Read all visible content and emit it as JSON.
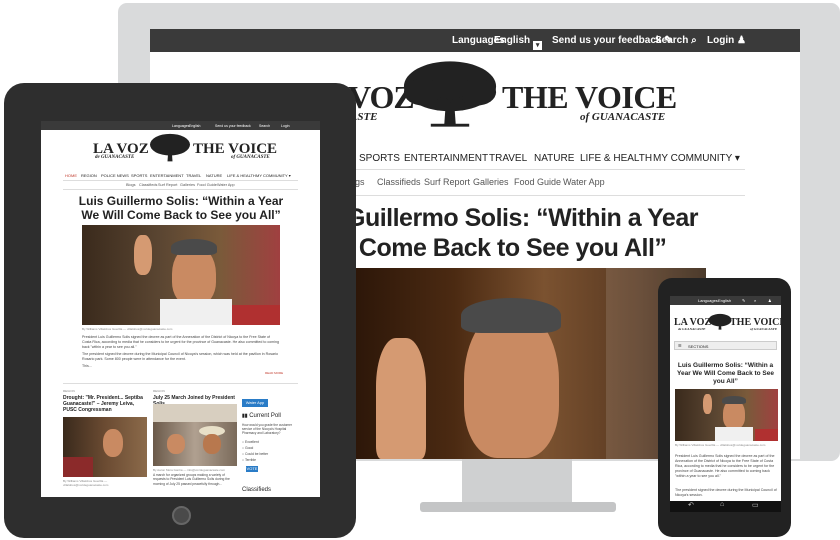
{
  "site": {
    "topbar": {
      "languages_label": "Languages",
      "language_value": "English",
      "feedback": "Send us your feedback",
      "search": "Search",
      "login": "Login"
    },
    "logo": {
      "left_title": "LA VOZ",
      "left_sub": "de GUANACASTE",
      "right_title": "THE VOICE",
      "right_sub": "of GUANACASTE"
    },
    "monitor_logo_left_visible": "VOZ",
    "monitor_logo_left_sub_visible": "ASTE",
    "nav": [
      "HOME",
      "REGION",
      "POLICE NEWS",
      "SPORTS",
      "ENTERTAINMENT",
      "TRAVEL",
      "NATURE",
      "LIFE & HEALTH",
      "MY COMMUNITY ▾"
    ],
    "monitor_nav": [
      "SPORTS",
      "ENTERTAINMENT",
      "TRAVEL",
      "NATURE",
      "LIFE & HEALTH",
      "MY COMMUNITY ▾"
    ],
    "subnav": [
      "Blogs",
      "Classifieds",
      "Surf Report",
      "Galleries",
      "Food Guide",
      "Water App"
    ],
    "monitor_subnav": [
      "ogs",
      "Classifieds",
      "Surf Report",
      "Galleries",
      "Food Guide",
      "Water App"
    ],
    "headline": "Luis Guillermo Solis: “Within a Year We Will Come Back to See you All”",
    "monitor_headline_lines": [
      "Guillermo Solis: “Within a Year",
      "l Come Back to See you All”"
    ],
    "tablet_headline_lines": [
      "Luis Guillermo Solis: “Within a Year",
      "We Will Come Back to See you All”"
    ],
    "phone_headline_lines": [
      "Luis Guillermo Solis: “Within a",
      "Year We Will Come Back to See",
      "you All”"
    ]
  },
  "tablet": {
    "photo_credit": "By Williams Villalobos Guerilla — villalobos@vozdeguanacaste.com",
    "body_paragraphs": [
      "President Luis Guillermo Solis signed the decree as part of the Annexation of the District of Nicoya to the Free State of Costa Rica, according to media that he considers to be urgent for the province of Guanacaste. He also committed to coming back \"within a year to see you all.\"",
      "The president signed the decree during the Municipal Council of Nicoya's session, which was held at the pavilion in Rosario Rosario park. Some 800 people were in attendance for the event.",
      "This..."
    ],
    "read_more": "READ MORE",
    "col1": {
      "kicker": "REGION",
      "title": "Drought: \"Mr. President... Septiba Guanacaste!\" – Jeremy Leiva, PUSC Congressman",
      "credit": "By Williams Villalobos Guerilla — villalobos@vozdeguanacaste.com"
    },
    "col2": {
      "kicker": "REGION",
      "title": "July 25 March Joined by President Solis",
      "credit": "By Aaron Mora Garcia — info@vozdeguanacaste.com",
      "text": "A march for organized groups making a variety of requests to President Luis Guillermo Solis during the morning of July 25 passed peacefully through..."
    },
    "sidebar": {
      "water_app": "Water App",
      "poll_title": "Current Poll",
      "poll_question": "How would you grade the customer service of the Nicoya's Hospital Pharmacy and Laboratory?",
      "poll_options": [
        "Excellent",
        "Good",
        "Could be better",
        "Terrible"
      ],
      "vote": "VOTE",
      "classifieds": "Classifieds"
    }
  },
  "phone": {
    "sections": "SECTIONS",
    "photo_credit": "By Williams Villalobos Guerilla — villalobos@vozdeguanacaste.com",
    "body_paragraphs": [
      "President Luis Guillermo Solis signed the decree as part of the Annexation of the District of Nicoya to the Free State of Costa Rica, according to media that he considers to be urgent for the province of Guanacaste. He also committed to coming back \"within a year to see you all.\"",
      "The president signed the decree during the Municipal Council of Nicoya's session."
    ]
  },
  "icons": [
    "pen-icon",
    "search-icon",
    "user-icon",
    "dropdown-icon",
    "oak-tree-logo-icon",
    "back-icon",
    "home-icon",
    "recents-icon"
  ],
  "colors": {
    "topbar": "#3a3a3a",
    "device_dark": "#2e2e2e",
    "monitor_frame": "#d9dadb",
    "button_blue": "#2a7cc7"
  }
}
